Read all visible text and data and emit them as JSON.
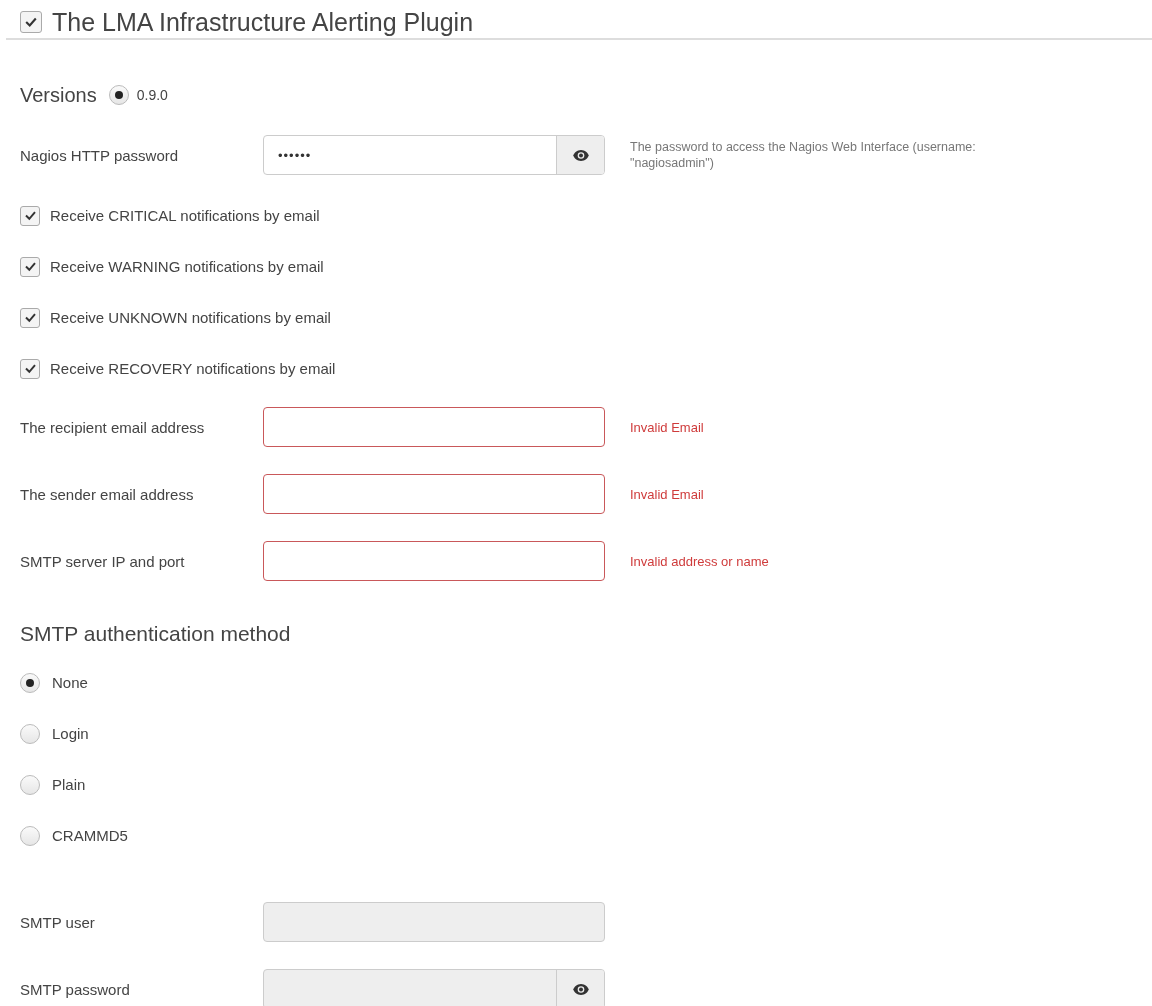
{
  "plugin": {
    "title": "The LMA Infrastructure Alerting Plugin",
    "enabled": true
  },
  "versions": {
    "label": "Versions",
    "options": [
      {
        "label": "0.9.0",
        "selected": true
      }
    ]
  },
  "settings": [
    {
      "kind": "password",
      "label": "Nagios HTTP password",
      "value": "••••••",
      "disabled": false,
      "hint": "The password to access the Nagios Web Interface (username: \"nagiosadmin\")"
    },
    {
      "kind": "checkbox",
      "label": "Receive CRITICAL notifications by email",
      "checked": true
    },
    {
      "kind": "checkbox",
      "label": "Receive WARNING notifications by email",
      "checked": true
    },
    {
      "kind": "checkbox",
      "label": "Receive UNKNOWN notifications by email",
      "checked": true
    },
    {
      "kind": "checkbox",
      "label": "Receive RECOVERY notifications by email",
      "checked": true
    },
    {
      "kind": "text",
      "label": "The recipient email address",
      "disabled": false,
      "error": "Invalid Email"
    },
    {
      "kind": "text",
      "label": "The sender email address",
      "disabled": false,
      "error": "Invalid Email"
    },
    {
      "kind": "text",
      "label": "SMTP server IP and port",
      "disabled": false,
      "error": "Invalid address or name"
    }
  ],
  "auth": {
    "heading": "SMTP authentication method",
    "options": [
      {
        "label": "None",
        "selected": true
      },
      {
        "label": "Login",
        "selected": false
      },
      {
        "label": "Plain",
        "selected": false
      },
      {
        "label": "CRAMMD5",
        "selected": false
      }
    ]
  },
  "credentials": [
    {
      "kind": "text",
      "label": "SMTP user",
      "disabled": true
    },
    {
      "kind": "password",
      "label": "SMTP password",
      "disabled": true
    }
  ]
}
